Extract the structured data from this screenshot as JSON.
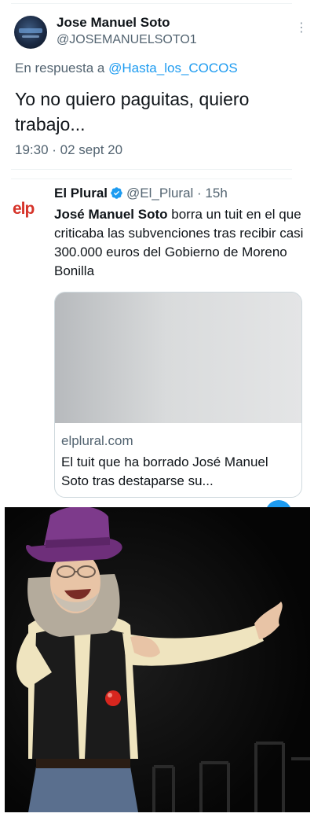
{
  "tweet_top": {
    "author_name": "Jose Manuel Soto",
    "author_handle": "@JOSEMANUELSOTO1",
    "more_icon": "more-vertical-icon",
    "reply_prefix": "En respuesta a",
    "reply_mention": "@Hasta_los_COCOS",
    "text": "Yo no quiero paguitas, quiero trabajo...",
    "timestamp": "19:30 · 02 sept 20"
  },
  "tweet_quoted": {
    "logo_text": "elp",
    "author_name": "El Plural",
    "verified_icon": "verified-badge-icon",
    "author_handle": "@El_Plural · 15h",
    "text_bold": "José Manuel Soto",
    "text_rest": " borra un tuit en el que criticaba las subvenciones tras recibir casi 300.000 euros del Gobierno de Moreno Bonilla",
    "card": {
      "image": "portrait-photo",
      "domain": "elplural.com",
      "title": "El tuit que ha borrado José Manuel Soto tras destaparse su..."
    }
  },
  "photo_bottom": {
    "image": "stage-performer-photo"
  },
  "colors": {
    "accent": "#1d9bf0",
    "secondary_text": "#536471",
    "primary_text": "#0f1419",
    "logo_red": "#d6342a"
  }
}
